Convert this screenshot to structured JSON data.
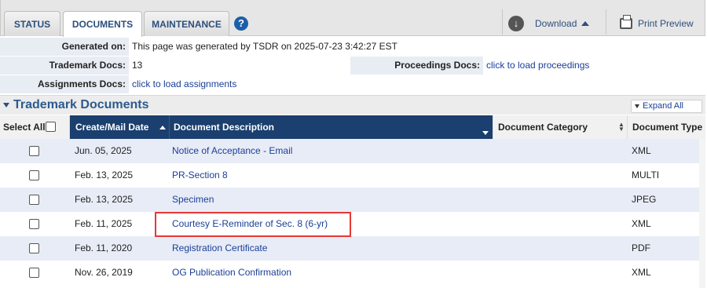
{
  "tabs": [
    {
      "label": "STATUS"
    },
    {
      "label": "DOCUMENTS"
    },
    {
      "label": "MAINTENANCE"
    }
  ],
  "toolbar": {
    "help_glyph": "?",
    "download_label": "Download",
    "print_label": "Print Preview"
  },
  "info": {
    "generated_label": "Generated on:",
    "generated_value": "This page was generated by TSDR on 2025-07-23 3:42:27 EST",
    "trademark_docs_label": "Trademark Docs:",
    "trademark_docs_value": "13",
    "proceedings_label": "Proceedings Docs:",
    "proceedings_value": "click to load proceedings",
    "assignments_label": "Assignments Docs:",
    "assignments_value": "click to load assignments"
  },
  "section": {
    "title": "Trademark Documents",
    "expand_label": "Expand All"
  },
  "table": {
    "headers": {
      "select_all": "Select All",
      "date": "Create/Mail Date",
      "description": "Document Description",
      "category": "Document Category",
      "type": "Document Type"
    },
    "rows": [
      {
        "date": "Jun. 05, 2025",
        "description": "Notice of Acceptance - Email",
        "category": "",
        "type": "XML"
      },
      {
        "date": "Feb. 13, 2025",
        "description": "PR-Section 8",
        "category": "",
        "type": "MULTI"
      },
      {
        "date": "Feb. 13, 2025",
        "description": "Specimen",
        "category": "",
        "type": "JPEG"
      },
      {
        "date": "Feb. 11, 2025",
        "description": "Courtesy E-Reminder of Sec. 8 (6-yr)",
        "category": "",
        "type": "XML"
      },
      {
        "date": "Feb. 11, 2020",
        "description": "Registration Certificate",
        "category": "",
        "type": "PDF"
      },
      {
        "date": "Nov. 26, 2019",
        "description": "OG Publication Confirmation",
        "category": "",
        "type": "XML"
      }
    ]
  },
  "colors": {
    "header_navy": "#1b3f6e",
    "link_blue": "#1a3f96",
    "row_alt": "#e8ecf7",
    "highlight_red": "#e53935"
  }
}
